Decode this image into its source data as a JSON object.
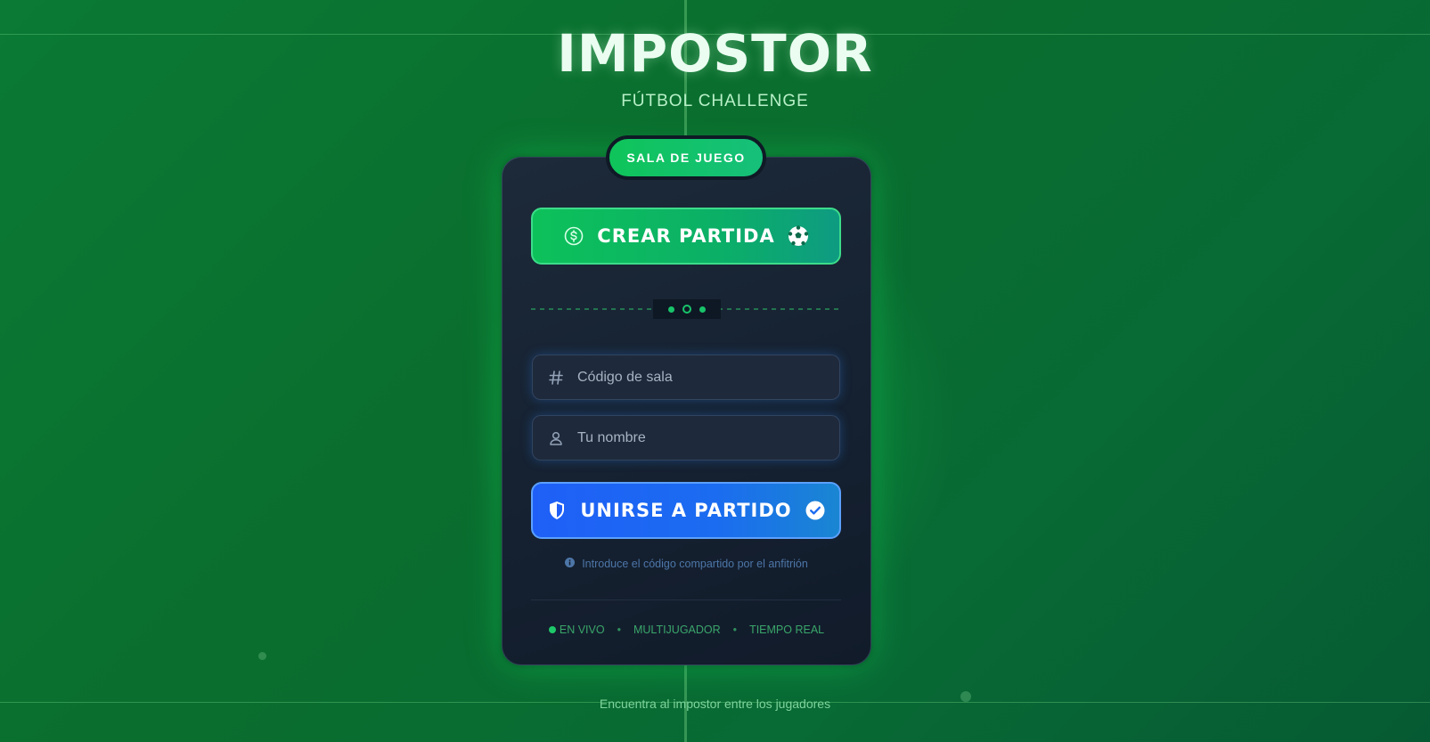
{
  "app": {
    "title": "IMPOSTOR",
    "subtitle": "FÚTBOL CHALLENGE"
  },
  "card": {
    "badge": "SALA DE JUEGO",
    "create_button": "CREAR PARTIDA",
    "room_code_input": {
      "placeholder": "Código de sala",
      "value": ""
    },
    "name_input": {
      "placeholder": "Tu nombre",
      "value": ""
    },
    "join_button": "UNIRSE A PARTIDO",
    "hint": "Introduce el código compartido por el anfitrión",
    "tags": {
      "live": "EN VIVO",
      "multiplayer": "MULTIJUGADOR",
      "realtime": "TIEMPO REAL"
    }
  },
  "footer": {
    "tagline": "Encuentra al impostor entre los jugadores"
  },
  "icons": {
    "create_left": "dollar-circle-icon",
    "create_right": "soccer-ball-icon",
    "room_code": "hash-icon",
    "name": "user-icon",
    "join_left": "shield-icon",
    "join_right": "check-circle-icon",
    "hint": "info-icon"
  },
  "colors": {
    "accent_green": "#0dc15a",
    "accent_blue": "#1f5ff7",
    "card_bg": "#162232",
    "background": "#0a7a34"
  }
}
